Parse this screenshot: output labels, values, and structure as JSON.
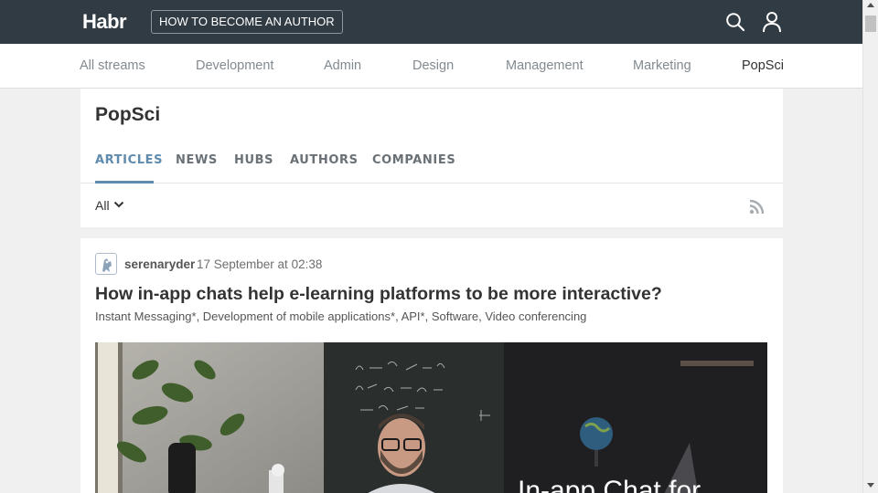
{
  "header": {
    "logo": "Habr",
    "author_button": "HOW TO BECOME AN AUTHOR",
    "icons": [
      "search-icon",
      "user-icon"
    ]
  },
  "streams": {
    "items": [
      {
        "label": "All streams",
        "active": false
      },
      {
        "label": "Development",
        "active": false
      },
      {
        "label": "Admin",
        "active": false
      },
      {
        "label": "Design",
        "active": false
      },
      {
        "label": "Management",
        "active": false
      },
      {
        "label": "Marketing",
        "active": false
      },
      {
        "label": "PopSci",
        "active": true
      }
    ]
  },
  "hub": {
    "title": "PopSci",
    "tabs": [
      {
        "label": "ARTICLES",
        "active": true
      },
      {
        "label": "NEWS",
        "active": false
      },
      {
        "label": "HUBS",
        "active": false
      },
      {
        "label": "AUTHORS",
        "active": false
      },
      {
        "label": "COMPANIES",
        "active": false
      }
    ],
    "filter": "All",
    "icons": [
      "chevron-down-icon",
      "rss-icon"
    ]
  },
  "article": {
    "author": "serenaryder",
    "time": "17 September at 02:38",
    "title": "How in-app chats help e-learning platforms to be more interactive?",
    "hubs": "Instant Messaging*, Development of mobile applications*, API*, Software, Video conferencing",
    "image_text": "In-app Chat for"
  },
  "colors": {
    "header_bg": "#303b44",
    "accent": "#5e8bae",
    "page_bg": "#f0f0f0"
  }
}
